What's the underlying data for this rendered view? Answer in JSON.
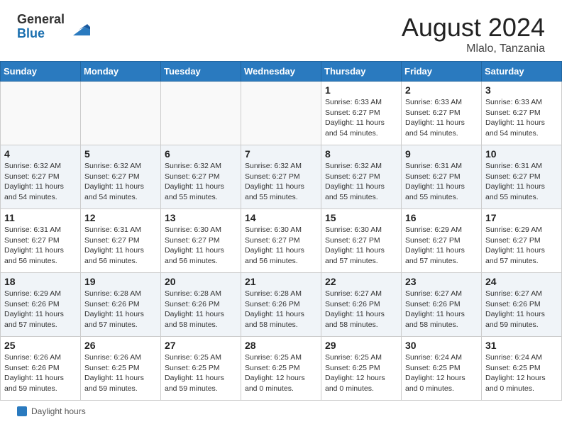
{
  "header": {
    "logo_line1": "General",
    "logo_line2": "Blue",
    "month_year": "August 2024",
    "location": "Mlalo, Tanzania"
  },
  "footer": {
    "daylight_label": "Daylight hours"
  },
  "weekdays": [
    "Sunday",
    "Monday",
    "Tuesday",
    "Wednesday",
    "Thursday",
    "Friday",
    "Saturday"
  ],
  "weeks": [
    [
      {
        "day": "",
        "info": ""
      },
      {
        "day": "",
        "info": ""
      },
      {
        "day": "",
        "info": ""
      },
      {
        "day": "",
        "info": ""
      },
      {
        "day": "1",
        "info": "Sunrise: 6:33 AM\nSunset: 6:27 PM\nDaylight: 11 hours and 54 minutes."
      },
      {
        "day": "2",
        "info": "Sunrise: 6:33 AM\nSunset: 6:27 PM\nDaylight: 11 hours and 54 minutes."
      },
      {
        "day": "3",
        "info": "Sunrise: 6:33 AM\nSunset: 6:27 PM\nDaylight: 11 hours and 54 minutes."
      }
    ],
    [
      {
        "day": "4",
        "info": "Sunrise: 6:32 AM\nSunset: 6:27 PM\nDaylight: 11 hours and 54 minutes."
      },
      {
        "day": "5",
        "info": "Sunrise: 6:32 AM\nSunset: 6:27 PM\nDaylight: 11 hours and 54 minutes."
      },
      {
        "day": "6",
        "info": "Sunrise: 6:32 AM\nSunset: 6:27 PM\nDaylight: 11 hours and 55 minutes."
      },
      {
        "day": "7",
        "info": "Sunrise: 6:32 AM\nSunset: 6:27 PM\nDaylight: 11 hours and 55 minutes."
      },
      {
        "day": "8",
        "info": "Sunrise: 6:32 AM\nSunset: 6:27 PM\nDaylight: 11 hours and 55 minutes."
      },
      {
        "day": "9",
        "info": "Sunrise: 6:31 AM\nSunset: 6:27 PM\nDaylight: 11 hours and 55 minutes."
      },
      {
        "day": "10",
        "info": "Sunrise: 6:31 AM\nSunset: 6:27 PM\nDaylight: 11 hours and 55 minutes."
      }
    ],
    [
      {
        "day": "11",
        "info": "Sunrise: 6:31 AM\nSunset: 6:27 PM\nDaylight: 11 hours and 56 minutes."
      },
      {
        "day": "12",
        "info": "Sunrise: 6:31 AM\nSunset: 6:27 PM\nDaylight: 11 hours and 56 minutes."
      },
      {
        "day": "13",
        "info": "Sunrise: 6:30 AM\nSunset: 6:27 PM\nDaylight: 11 hours and 56 minutes."
      },
      {
        "day": "14",
        "info": "Sunrise: 6:30 AM\nSunset: 6:27 PM\nDaylight: 11 hours and 56 minutes."
      },
      {
        "day": "15",
        "info": "Sunrise: 6:30 AM\nSunset: 6:27 PM\nDaylight: 11 hours and 57 minutes."
      },
      {
        "day": "16",
        "info": "Sunrise: 6:29 AM\nSunset: 6:27 PM\nDaylight: 11 hours and 57 minutes."
      },
      {
        "day": "17",
        "info": "Sunrise: 6:29 AM\nSunset: 6:27 PM\nDaylight: 11 hours and 57 minutes."
      }
    ],
    [
      {
        "day": "18",
        "info": "Sunrise: 6:29 AM\nSunset: 6:26 PM\nDaylight: 11 hours and 57 minutes."
      },
      {
        "day": "19",
        "info": "Sunrise: 6:28 AM\nSunset: 6:26 PM\nDaylight: 11 hours and 57 minutes."
      },
      {
        "day": "20",
        "info": "Sunrise: 6:28 AM\nSunset: 6:26 PM\nDaylight: 11 hours and 58 minutes."
      },
      {
        "day": "21",
        "info": "Sunrise: 6:28 AM\nSunset: 6:26 PM\nDaylight: 11 hours and 58 minutes."
      },
      {
        "day": "22",
        "info": "Sunrise: 6:27 AM\nSunset: 6:26 PM\nDaylight: 11 hours and 58 minutes."
      },
      {
        "day": "23",
        "info": "Sunrise: 6:27 AM\nSunset: 6:26 PM\nDaylight: 11 hours and 58 minutes."
      },
      {
        "day": "24",
        "info": "Sunrise: 6:27 AM\nSunset: 6:26 PM\nDaylight: 11 hours and 59 minutes."
      }
    ],
    [
      {
        "day": "25",
        "info": "Sunrise: 6:26 AM\nSunset: 6:26 PM\nDaylight: 11 hours and 59 minutes."
      },
      {
        "day": "26",
        "info": "Sunrise: 6:26 AM\nSunset: 6:25 PM\nDaylight: 11 hours and 59 minutes."
      },
      {
        "day": "27",
        "info": "Sunrise: 6:25 AM\nSunset: 6:25 PM\nDaylight: 11 hours and 59 minutes."
      },
      {
        "day": "28",
        "info": "Sunrise: 6:25 AM\nSunset: 6:25 PM\nDaylight: 12 hours and 0 minutes."
      },
      {
        "day": "29",
        "info": "Sunrise: 6:25 AM\nSunset: 6:25 PM\nDaylight: 12 hours and 0 minutes."
      },
      {
        "day": "30",
        "info": "Sunrise: 6:24 AM\nSunset: 6:25 PM\nDaylight: 12 hours and 0 minutes."
      },
      {
        "day": "31",
        "info": "Sunrise: 6:24 AM\nSunset: 6:25 PM\nDaylight: 12 hours and 0 minutes."
      }
    ]
  ]
}
